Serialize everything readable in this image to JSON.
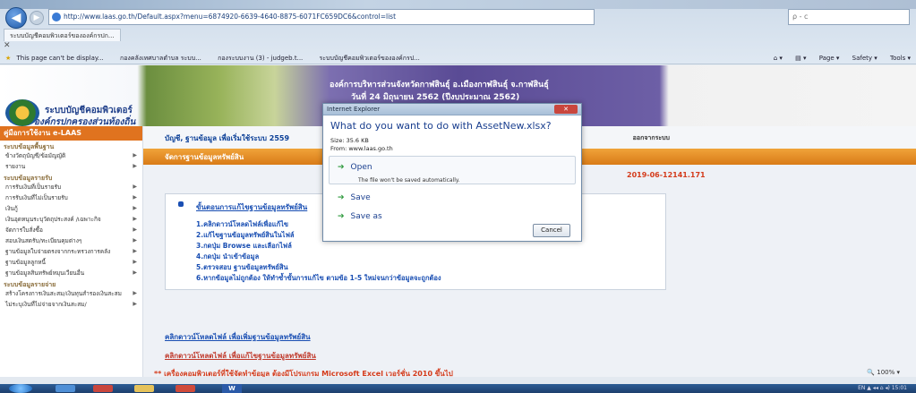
{
  "browser": {
    "address": "http://www.laas.go.th/Default.aspx?menu=6874920-6639-4640-8875-6071FC659DC6&control=list",
    "tab_label": "ระบบบัญชีคอมพิวเตอร์ขององค์กรปก...",
    "search_placeholder": "ρ - c",
    "favorites": [
      "This page can't be display...",
      "กองคลังเทศบาลตำบล ระบบ...",
      "กองระบบงาน (3) - judgeb.t...",
      "ระบบบัญชีคอมพิวเตอร์ขององค์กรป..."
    ],
    "commands": [
      "Page ▾",
      "Safety ▾",
      "Tools ▾"
    ],
    "zoom": "100%"
  },
  "site": {
    "logo_title": "ระบบบัญชีคอมพิวเตอร์",
    "logo_subtitle": "องค์กรปกครองส่วนท้องถิ่น",
    "banner_line1": "องค์การบริหารส่วนจังหวัดกาฬสินธุ์ อ.เมืองกาฬสินธุ์ จ.กาฬสินธุ์",
    "banner_line2": "วันที่ 24 มิถุนายน 2562  (ปีงบประมาณ 2562)"
  },
  "status": {
    "left": "บัญชี, ฐานข้อมูล เพื่อเริ่มใช้ระบบ 2559",
    "right": "ออกจากระบบ",
    "datestamp": "2019-06-12141.171"
  },
  "page_header": "จัดการฐานข้อมูลทรัพย์สิน",
  "sidebar": {
    "head": "คู่มือการใช้งาน e-LAAS",
    "groups": [
      {
        "title": "ระบบข้อมูลพื้นฐาน",
        "items": [
          "ข้างวัตถุบัญชี/ข้อมัญญัติ",
          "รายงาน"
        ]
      },
      {
        "title": "ระบบข้อมูลรายรับ",
        "items": [
          "การรับเงินที่เป็นรายรับ",
          "การรับเงินที่ไม่เป็นรายรับ",
          "เงินกู้",
          "เงินอุดหนุนระบุวัตถุประสงค์ /เฉพาะกิจ",
          "จัดการใบสั่งซื้อ",
          "สอบเงินสดรับ/ทะเบียนคุมต่างๆ",
          "ฐานข้อมูลใบจ่ายตรงจากกระทรวงการคลัง",
          "ฐานข้อมูลลูกหนี้",
          "ฐานข้อมูลสินทรัพย์หมุนเวียนอื่น"
        ]
      },
      {
        "title": "ระบบข้อมูลรายจ่าย",
        "items": [
          "สร้างโครงการเงินสะสม/เงินทุนสำรองเงินสะสม",
          "ไม่ระบุเงินที่ไม่จ่ายจากเงินสะสม/"
        ]
      }
    ]
  },
  "instructions": {
    "title": "ขั้นตอนการแก้ไขฐานข้อมูลทรัพย์สิน",
    "steps": [
      "1.คลิกดาวน์โหลดไฟล์เพื่อแก้ไข",
      "2.แก้ไขฐานข้อมูลทรัพย์สินในไฟล์",
      "3.กดปุ่ม Browse และเลือกไฟล์",
      "4.กดปุ่ม นำเข้าข้อมูล",
      "5.ตรวจสอบ ฐานข้อมูลทรัพย์สิน",
      "6.หากข้อมูลไม่ถูกต้อง ให้ทำซ้ำขั้นการแก้ไข ตามข้อ 1-5 ใหม่จนกว่าข้อมูลจะถูกต้อง"
    ]
  },
  "links": {
    "download_add": "คลิกดาวน์โหลดไฟล์ เพื่อเพิ่มฐานข้อมูลทรัพย์สิน",
    "download_edit": "คลิกดาวน์โหลดไฟล์ เพื่อแก้ไขฐานข้อมูลทรัพย์สิน",
    "warning": "** เครื่องคอมพิวเตอร์ที่ใช้จัดทำข้อมูล ต้องมีโปรแกรม Microsoft Excel เวอร์ชั่น 2010 ขึ้นไป"
  },
  "dialog": {
    "titlebar": "Internet Explorer",
    "question": "What do you want to do with AssetNew.xlsx?",
    "size": "Size: 35.6 KB",
    "from": "From: www.laas.go.th",
    "open_label": "Open",
    "open_sub": "The file won't be saved automatically.",
    "save_label": "Save",
    "saveas_label": "Save as",
    "cancel_label": "Cancel"
  },
  "taskbar": {
    "word_label": "W",
    "tray": "EN  ▲  ◂◂  ⌂  ◂)  15:01"
  }
}
